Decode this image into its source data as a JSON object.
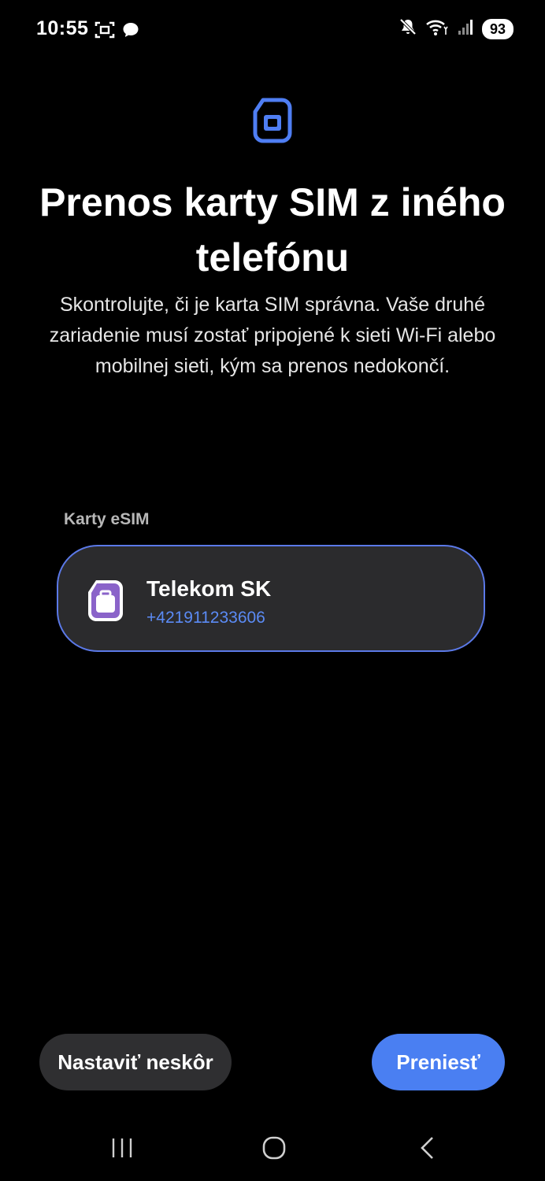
{
  "status_bar": {
    "time": "10:55",
    "battery_level": "93",
    "icons": [
      "screenshot-icon",
      "chat-icon",
      "mute-icon",
      "wifi-icon",
      "signal-icon"
    ]
  },
  "header": {
    "title": "Prenos karty SIM z iného telefónu",
    "description": "Skontrolujte, či je karta SIM správna. Vaše druhé zariadenie musí zostať pripojené k sieti Wi-Fi alebo mobilnej sieti, kým sa prenos nedokončí."
  },
  "esim_section": {
    "label": "Karty eSIM",
    "cards": [
      {
        "carrier": "Telekom SK",
        "number": "+421911233606",
        "selected": true
      }
    ]
  },
  "actions": {
    "later_label": "Nastaviť neskôr",
    "transfer_label": "Preniesť"
  },
  "navigation": {
    "buttons": [
      "recents-icon",
      "home-icon",
      "back-icon"
    ]
  },
  "colors": {
    "background": "#000000",
    "accent": "#4a7ff2",
    "card_border": "#5b79e8",
    "card_background": "#2b2b2d",
    "sim_icon_blue": "#4f7ef3",
    "esim_icon_purple": "#8a63c9",
    "secondary_button": "#2f2f31"
  }
}
